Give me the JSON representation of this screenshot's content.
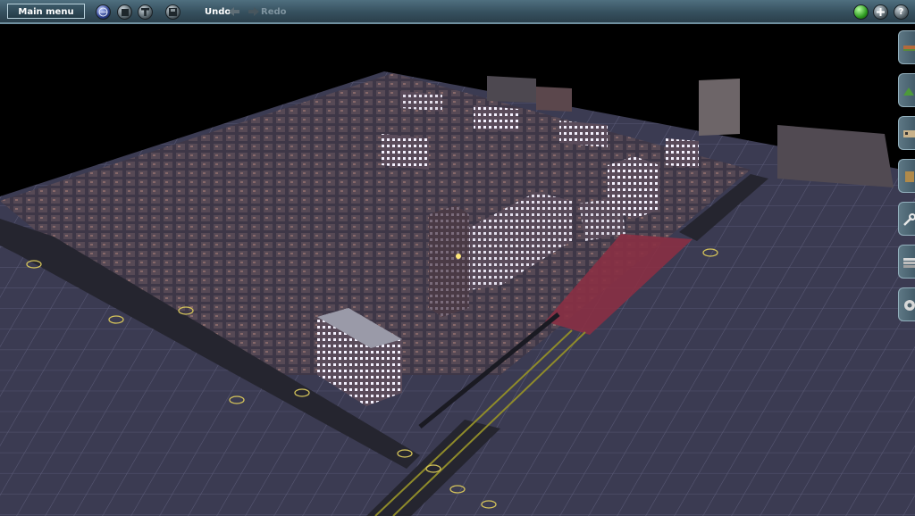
{
  "toolbar": {
    "main_menu_label": "Main menu",
    "undo_label": "Undo",
    "redo_label": "Redo",
    "left_icons": [
      "globe-icon",
      "stop-icon",
      "pause-icon",
      "save-icon"
    ],
    "right_icons": [
      "status-green-icon",
      "zoom-in-icon",
      "help-icon"
    ],
    "colors": {
      "bar": "#36505e",
      "accent": "#6f8f9f",
      "active_text": "#ffffff",
      "disabled_text": "#7f94a0"
    }
  },
  "side_toolbar": {
    "tools": [
      "track-tool-icon",
      "terrain-tool-icon",
      "vehicle-tool-icon",
      "station-tool-icon",
      "wrench-tool-icon",
      "layers-tool-icon",
      "settings-tool-icon"
    ]
  },
  "scene": {
    "description_colors": {
      "ground": "#3b3b52",
      "grid": "#5b5b78",
      "road": "#2a2a36",
      "window_light": "#f5f2ff",
      "rail_roof": "#8a3044"
    }
  }
}
